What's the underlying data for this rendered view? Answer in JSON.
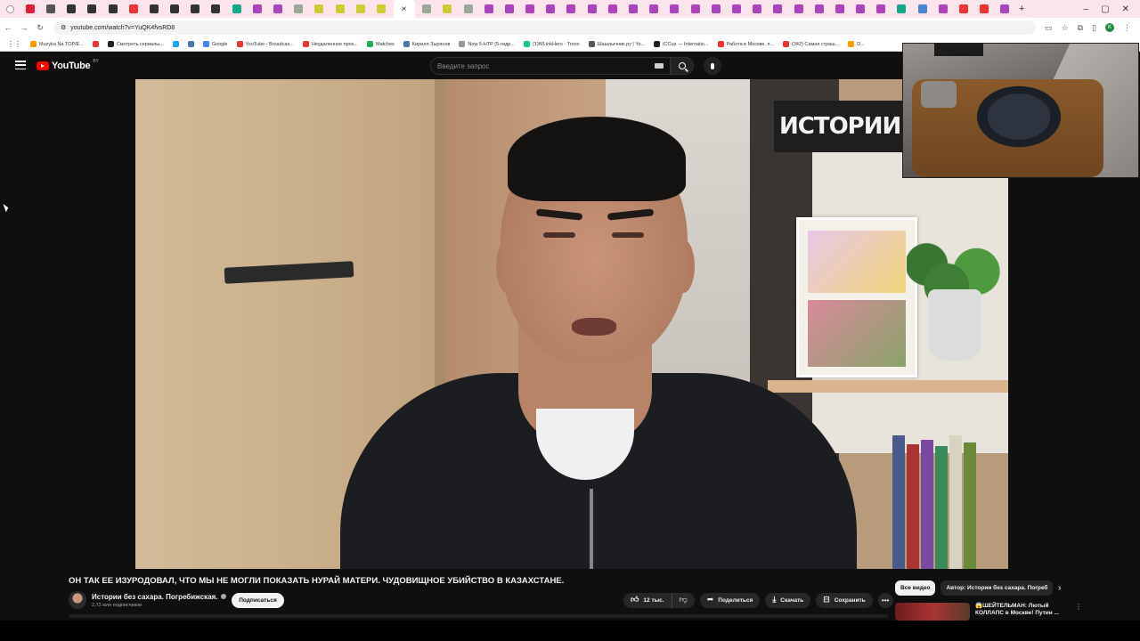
{
  "browser": {
    "active_tab_close": "×",
    "new_tab": "+",
    "url": "youtube.com/watch?v=YuQK4fvsRD8",
    "tab_colors": [
      "#d23",
      "#555",
      "#333",
      "#333",
      "#333",
      "#e33",
      "#333",
      "#333",
      "#333",
      "#333",
      "#1a8",
      "#a4b",
      "#a4b",
      "#9a9",
      "#cc3",
      "#cc3",
      "#cc3",
      "#cc3",
      "#9a9",
      "#cc3",
      "#9a9",
      "#a4b",
      "#a4b",
      "#a4b",
      "#a4b",
      "#a4b",
      "#a4b",
      "#a4b",
      "#a4b",
      "#a4b",
      "#a4b",
      "#a4b",
      "#a4b",
      "#a4b",
      "#a4b",
      "#a4b",
      "#a4b",
      "#a4b",
      "#a4b",
      "#a4b",
      "#a4b",
      "#1a8",
      "#48c",
      "#a4b",
      "#e33",
      "#e33",
      "#a4b"
    ],
    "window_controls": [
      "–",
      "▢",
      "✕"
    ],
    "bookmarks": [
      {
        "label": "Muzyka Na TOP/E...",
        "color": "#f90"
      },
      {
        "label": "",
        "color": "#e33"
      },
      {
        "label": "Смотреть сериалы...",
        "color": "#222"
      },
      {
        "label": "",
        "color": "#1da1f2"
      },
      {
        "label": "",
        "color": "#4a76a8"
      },
      {
        "label": "Google",
        "color": "#4285f4"
      },
      {
        "label": "YouTube - Broadcas...",
        "color": "#e33"
      },
      {
        "label": "Неудаленное прох...",
        "color": "#e33"
      },
      {
        "label": "Matches",
        "color": "#2a5"
      },
      {
        "label": "Кирилл Зырянов",
        "color": "#4a76a8"
      },
      {
        "label": "Now 5-HTP (5-гидр...",
        "color": "#999"
      },
      {
        "label": "(1)WLinkHero - Trovo",
        "color": "#1c8"
      },
      {
        "label": "Шашлычник.ру | Yo...",
        "color": "#555"
      },
      {
        "label": "iCCup — Internatio...",
        "color": "#222"
      },
      {
        "label": "Работа в Москве, п...",
        "color": "#e33"
      },
      {
        "label": "(342) Самая страш...",
        "color": "#e33"
      },
      {
        "label": "D...",
        "color": "#f90"
      }
    ]
  },
  "youtube": {
    "region": "BY",
    "logo_text": "YouTube",
    "search_placeholder": "Введите запрос",
    "video_overlay_text": "ИСТОРИИ БЕЗ",
    "video_title": "ОН ТАК ЕЕ ИЗУРОДОВАЛ, ЧТО МЫ НЕ МОГЛИ ПОКАЗАТЬ НУРАЙ МАТЕРИ. ЧУДОВИЩНОЕ УБИЙСТВО В КАЗАХСТАНЕ.",
    "channel_name": "Истории без сахара. Погребижская.",
    "subscribers": "2,72 млн подписчиков",
    "subscribe_label": "Подписаться",
    "like_count": "12 тыс.",
    "share_label": "Поделиться",
    "download_label": "Скачать",
    "save_label": "Сохранить",
    "chips": [
      "Все видео",
      "Автор: Истории без сахара. Погреб"
    ],
    "rec_title": "😱ШЕЙТЕЛЬМАН: Лютый КОЛЛАПС в Москве! Путин ..."
  }
}
